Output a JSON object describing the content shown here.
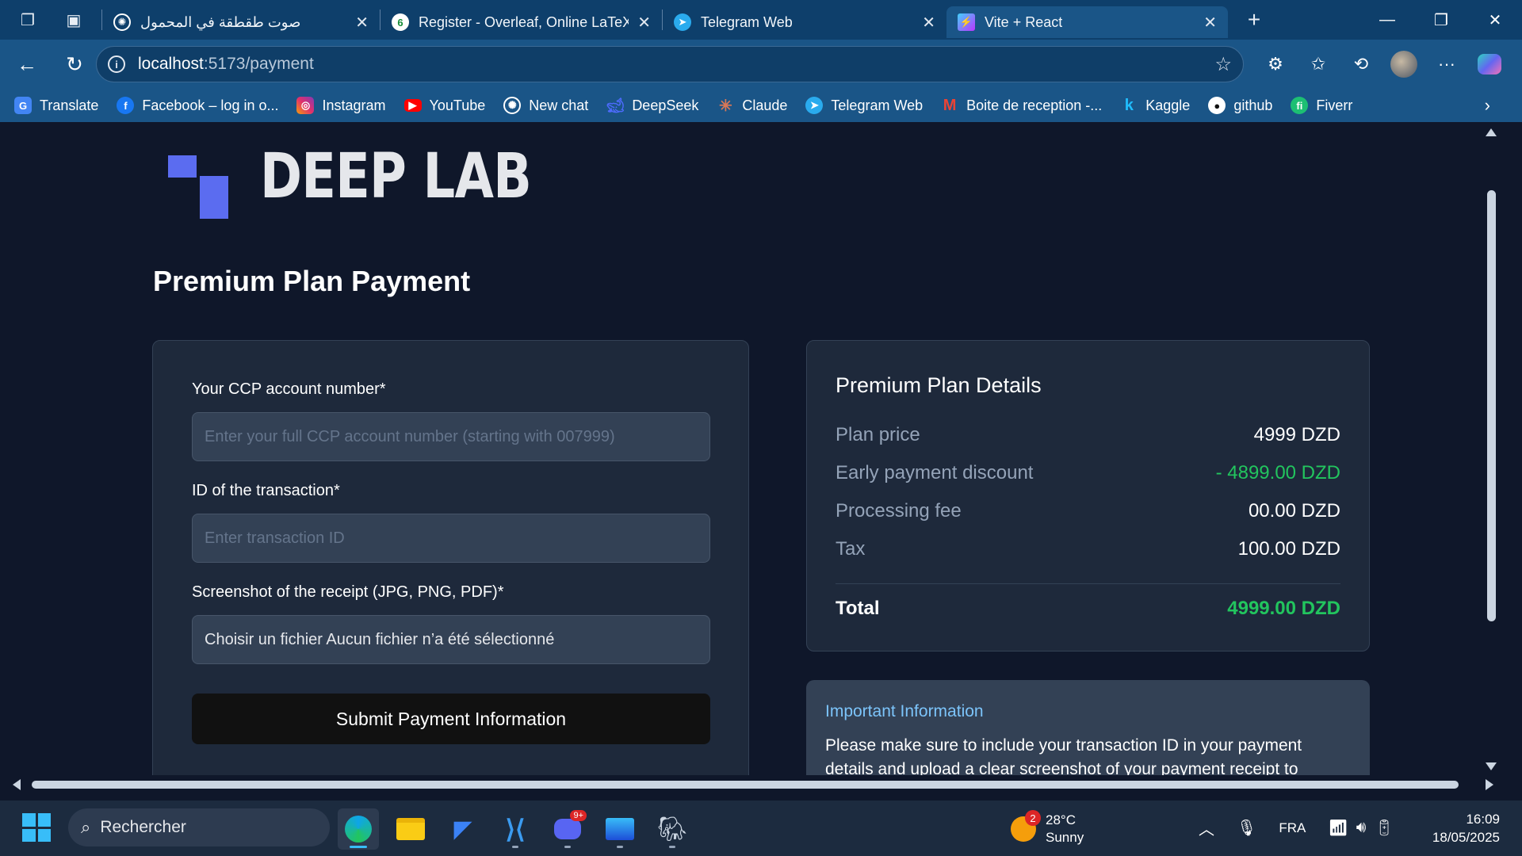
{
  "browser": {
    "tabs": [
      {
        "title": "صوت طقطقة في المحمول",
        "icon": "chatgpt-icon"
      },
      {
        "title": "Register - Overleaf, Online LaTeX E",
        "icon": "overleaf-icon"
      },
      {
        "title": "Telegram Web",
        "icon": "telegram-icon"
      },
      {
        "title": "Vite + React",
        "icon": "vite-icon",
        "active": true
      }
    ],
    "url_host": "localhost",
    "url_path": ":5173/payment",
    "bookmarks": [
      {
        "label": "Translate",
        "icon": "google-translate-icon",
        "color": "#4285f4"
      },
      {
        "label": "Facebook – log in o...",
        "icon": "facebook-icon",
        "color": "#1877f2"
      },
      {
        "label": "Instagram",
        "icon": "instagram-icon",
        "color": "#e1306c"
      },
      {
        "label": "YouTube",
        "icon": "youtube-icon",
        "color": "#ff0000"
      },
      {
        "label": "New chat",
        "icon": "chatgpt-icon",
        "color": "#ffffff"
      },
      {
        "label": "DeepSeek",
        "icon": "deepseek-icon",
        "color": "#4d6bfe"
      },
      {
        "label": "Claude",
        "icon": "claude-icon",
        "color": "#d97757"
      },
      {
        "label": "Telegram Web",
        "icon": "telegram-icon",
        "color": "#2aabee"
      },
      {
        "label": "Boite de reception -...",
        "icon": "gmail-icon",
        "color": "#ea4335"
      },
      {
        "label": "Kaggle",
        "icon": "kaggle-icon",
        "color": "#20beff"
      },
      {
        "label": "github",
        "icon": "github-icon",
        "color": "#ffffff"
      },
      {
        "label": "Fiverr",
        "icon": "fiverr-icon",
        "color": "#1dbf73"
      }
    ]
  },
  "page": {
    "logo_text": "DEEP LAB",
    "title": "Premium Plan Payment",
    "form": {
      "ccp_label": "Your CCP account number*",
      "ccp_placeholder": "Enter your full CCP account number (starting with 007999)",
      "txn_label": "ID of the transaction*",
      "txn_placeholder": "Enter transaction ID",
      "receipt_label": "Screenshot of the receipt (JPG, PNG, PDF)*",
      "receipt_value": "Choisir un fichier Aucun fichier n’a été sélectionné",
      "submit_label": "Submit Payment Information"
    },
    "details": {
      "title": "Premium Plan Details",
      "rows": [
        {
          "label": "Plan price",
          "value": "4999 DZD"
        },
        {
          "label": "Early payment discount",
          "value": "- 4899.00 DZD"
        },
        {
          "label": "Processing fee",
          "value": "00.00 DZD"
        },
        {
          "label": "Tax",
          "value": "100.00 DZD"
        }
      ],
      "total_label": "Total",
      "total_value": "4999.00 DZD"
    },
    "info": {
      "title": "Important Information",
      "text": "Please make sure to include your transaction ID in your payment details and upload a clear screenshot of your payment receipt to"
    }
  },
  "colors": {
    "accent_green": "#22c55e",
    "logo_blue": "#5b6cf0",
    "info_title": "#7cc4fa"
  },
  "taskbar": {
    "search_placeholder": "Rechercher",
    "weather_temp": "28°C",
    "weather_desc": "Sunny",
    "weather_badge": "2",
    "discord_badge": "9+",
    "language": "FRA",
    "time": "16:09",
    "date": "18/05/2025"
  }
}
